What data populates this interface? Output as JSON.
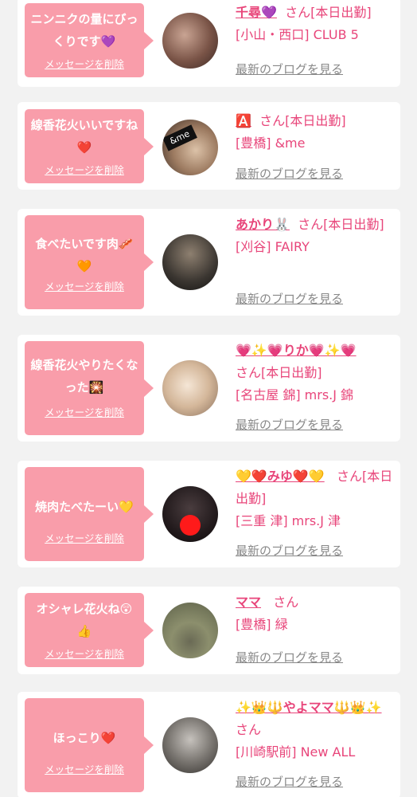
{
  "delete_label": "メッセージを削除",
  "blog_label": "最新のブログを見る",
  "colors": {
    "accent": "#e8457a",
    "bubble": "#f99daa",
    "link_gray": "#888888",
    "background": "#f2f2f2"
  },
  "posts": [
    {
      "message": "ニンニクの量にびっくりです💜",
      "name": "千尋💜",
      "status": "さん[本日出勤]",
      "shop": "[小山・西口] CLUB 5"
    },
    {
      "message": "線香花火いいですね❤️",
      "name": "🅰️",
      "status": "さん[本日出勤]",
      "shop": "[豊橋] &me"
    },
    {
      "message": "食べたいです肉🥓🧡",
      "name": "あかり🐰",
      "status": "さん[本日出勤]",
      "shop": "[刈谷] FAIRY"
    },
    {
      "message": "線香花火やりたくなった🎇",
      "name": "💗✨💗りか💗✨💗",
      "status": "さん[本日出勤]",
      "shop": "[名古屋 錦] mrs.J 錦"
    },
    {
      "message": "焼肉たべたーい💛",
      "name": "💛❤️みゆ❤️💛",
      "status": "さん[本日出勤]",
      "shop": "[三重 津] mrs.J 津"
    },
    {
      "message": "オシャレ花火ね😲👍",
      "name": "ママ",
      "status": "さん",
      "shop": "[豊橋] 緑"
    },
    {
      "message": "ほっこり❤️",
      "name": "✨👑🔱やよママ🔱👑✨",
      "status": "さん",
      "shop": "[川崎駅前] New ALL"
    }
  ]
}
